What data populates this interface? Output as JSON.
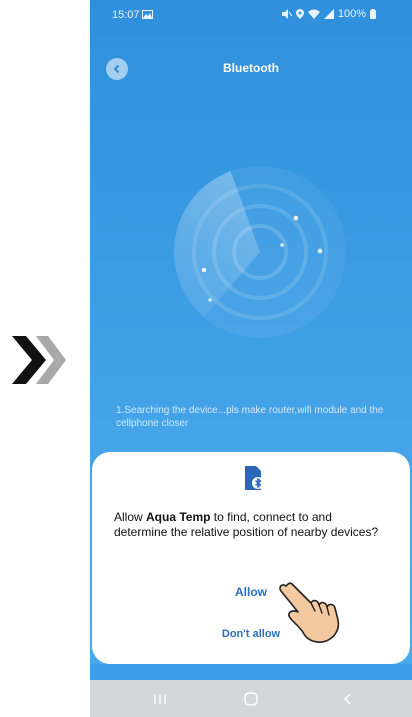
{
  "status_bar": {
    "time": "15:07",
    "battery": "100%"
  },
  "header": {
    "title": "Bluetooth"
  },
  "scan_hint": "1.Searching the device...pls make router,wifi module and the cellphone closer",
  "permission_dialog": {
    "message_prefix": "Allow ",
    "app_name": "Aqua Temp",
    "message_suffix": " to find, connect to and determine the relative position of nearby devices?",
    "allow_label": "Allow",
    "deny_label": "Don't allow"
  },
  "colors": {
    "screen_blue": "#3a9be3",
    "dialog_button": "#2c6fbe",
    "guide_arrow_dark": "#111111",
    "guide_arrow_light": "#a9a9a9"
  },
  "icons": [
    "back-icon",
    "gallery-icon",
    "mute-icon",
    "location-icon",
    "wifi-icon",
    "signal-icon",
    "battery-icon",
    "bluetooth-device-icon",
    "tap-hand-icon",
    "recents-icon",
    "home-icon",
    "nav-back-icon",
    "chevron-right-icon"
  ]
}
